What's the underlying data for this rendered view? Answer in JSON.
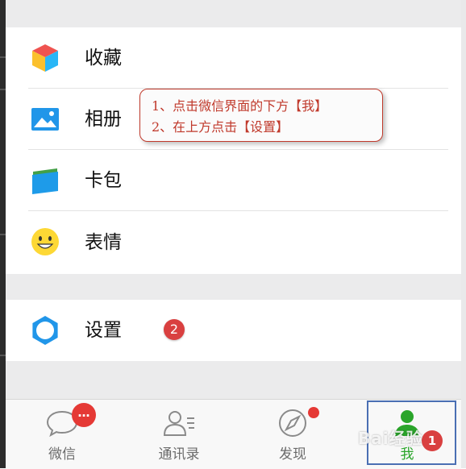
{
  "menu": {
    "favorites_label": "收藏",
    "album_label": "相册",
    "wallet_label": "卡包",
    "stickers_label": "表情",
    "settings_label": "设置",
    "settings_step_badge": "2"
  },
  "callout": {
    "line1": "1、点击微信界面的下方【我】",
    "line2": "2、在上方点击【设置】"
  },
  "tabbar": {
    "tabs": [
      {
        "label": "微信",
        "badge": "…"
      },
      {
        "label": "通讯录"
      },
      {
        "label": "发现"
      },
      {
        "label": "我",
        "step_badge": "1",
        "active": true
      }
    ]
  },
  "watermark": "Bai经验",
  "colors": {
    "accent_green": "#2aa52a",
    "badge_red": "#e53935",
    "callout_red": "#c0392b",
    "highlight_blue": "#4a6fb3",
    "icon_blue": "#2196e9"
  }
}
